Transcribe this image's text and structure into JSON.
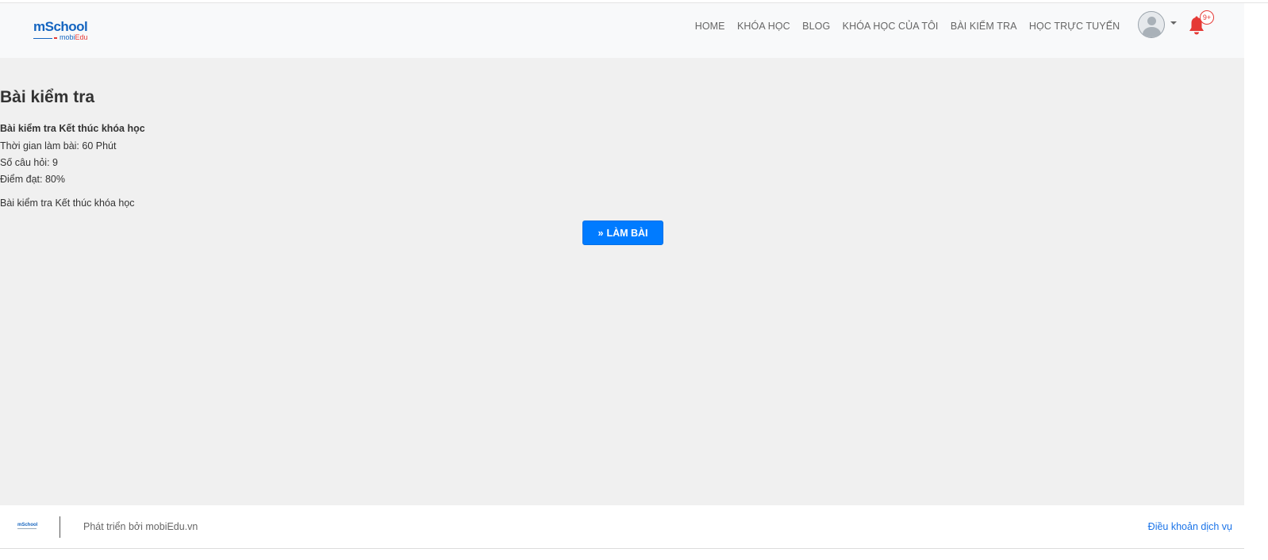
{
  "brand": {
    "logo_main": "mSchool",
    "logo_sub_a": "mobi",
    "logo_sub_b": "Edu"
  },
  "nav": {
    "items": [
      "HOME",
      "KHÓA HỌC",
      "BLOG",
      "KHÓA HỌC CỦA TÔI",
      "BÀI KIỂM TRA",
      "HỌC TRỰC TUYẾN"
    ],
    "notification_badge": "9+"
  },
  "exam": {
    "heading": "Bài kiểm tra",
    "name": "Bài kiểm tra Kết thúc khóa học",
    "duration": "Thời gian làm bài: 60 Phút",
    "questions": "Số câu hỏi: 9",
    "pass_score": "Điểm đạt: 80%",
    "description": "Bài kiểm tra Kết thúc khóa học",
    "start_button": "LÀM BÀI"
  },
  "footer": {
    "logo_text": "mSchool",
    "credit": "Phát triển bởi mobiEdu.vn",
    "terms_link": "Điều khoản dịch vụ"
  },
  "colors": {
    "primary": "#007bff",
    "brand_blue": "#1565c0",
    "notify_red": "#e53935"
  }
}
